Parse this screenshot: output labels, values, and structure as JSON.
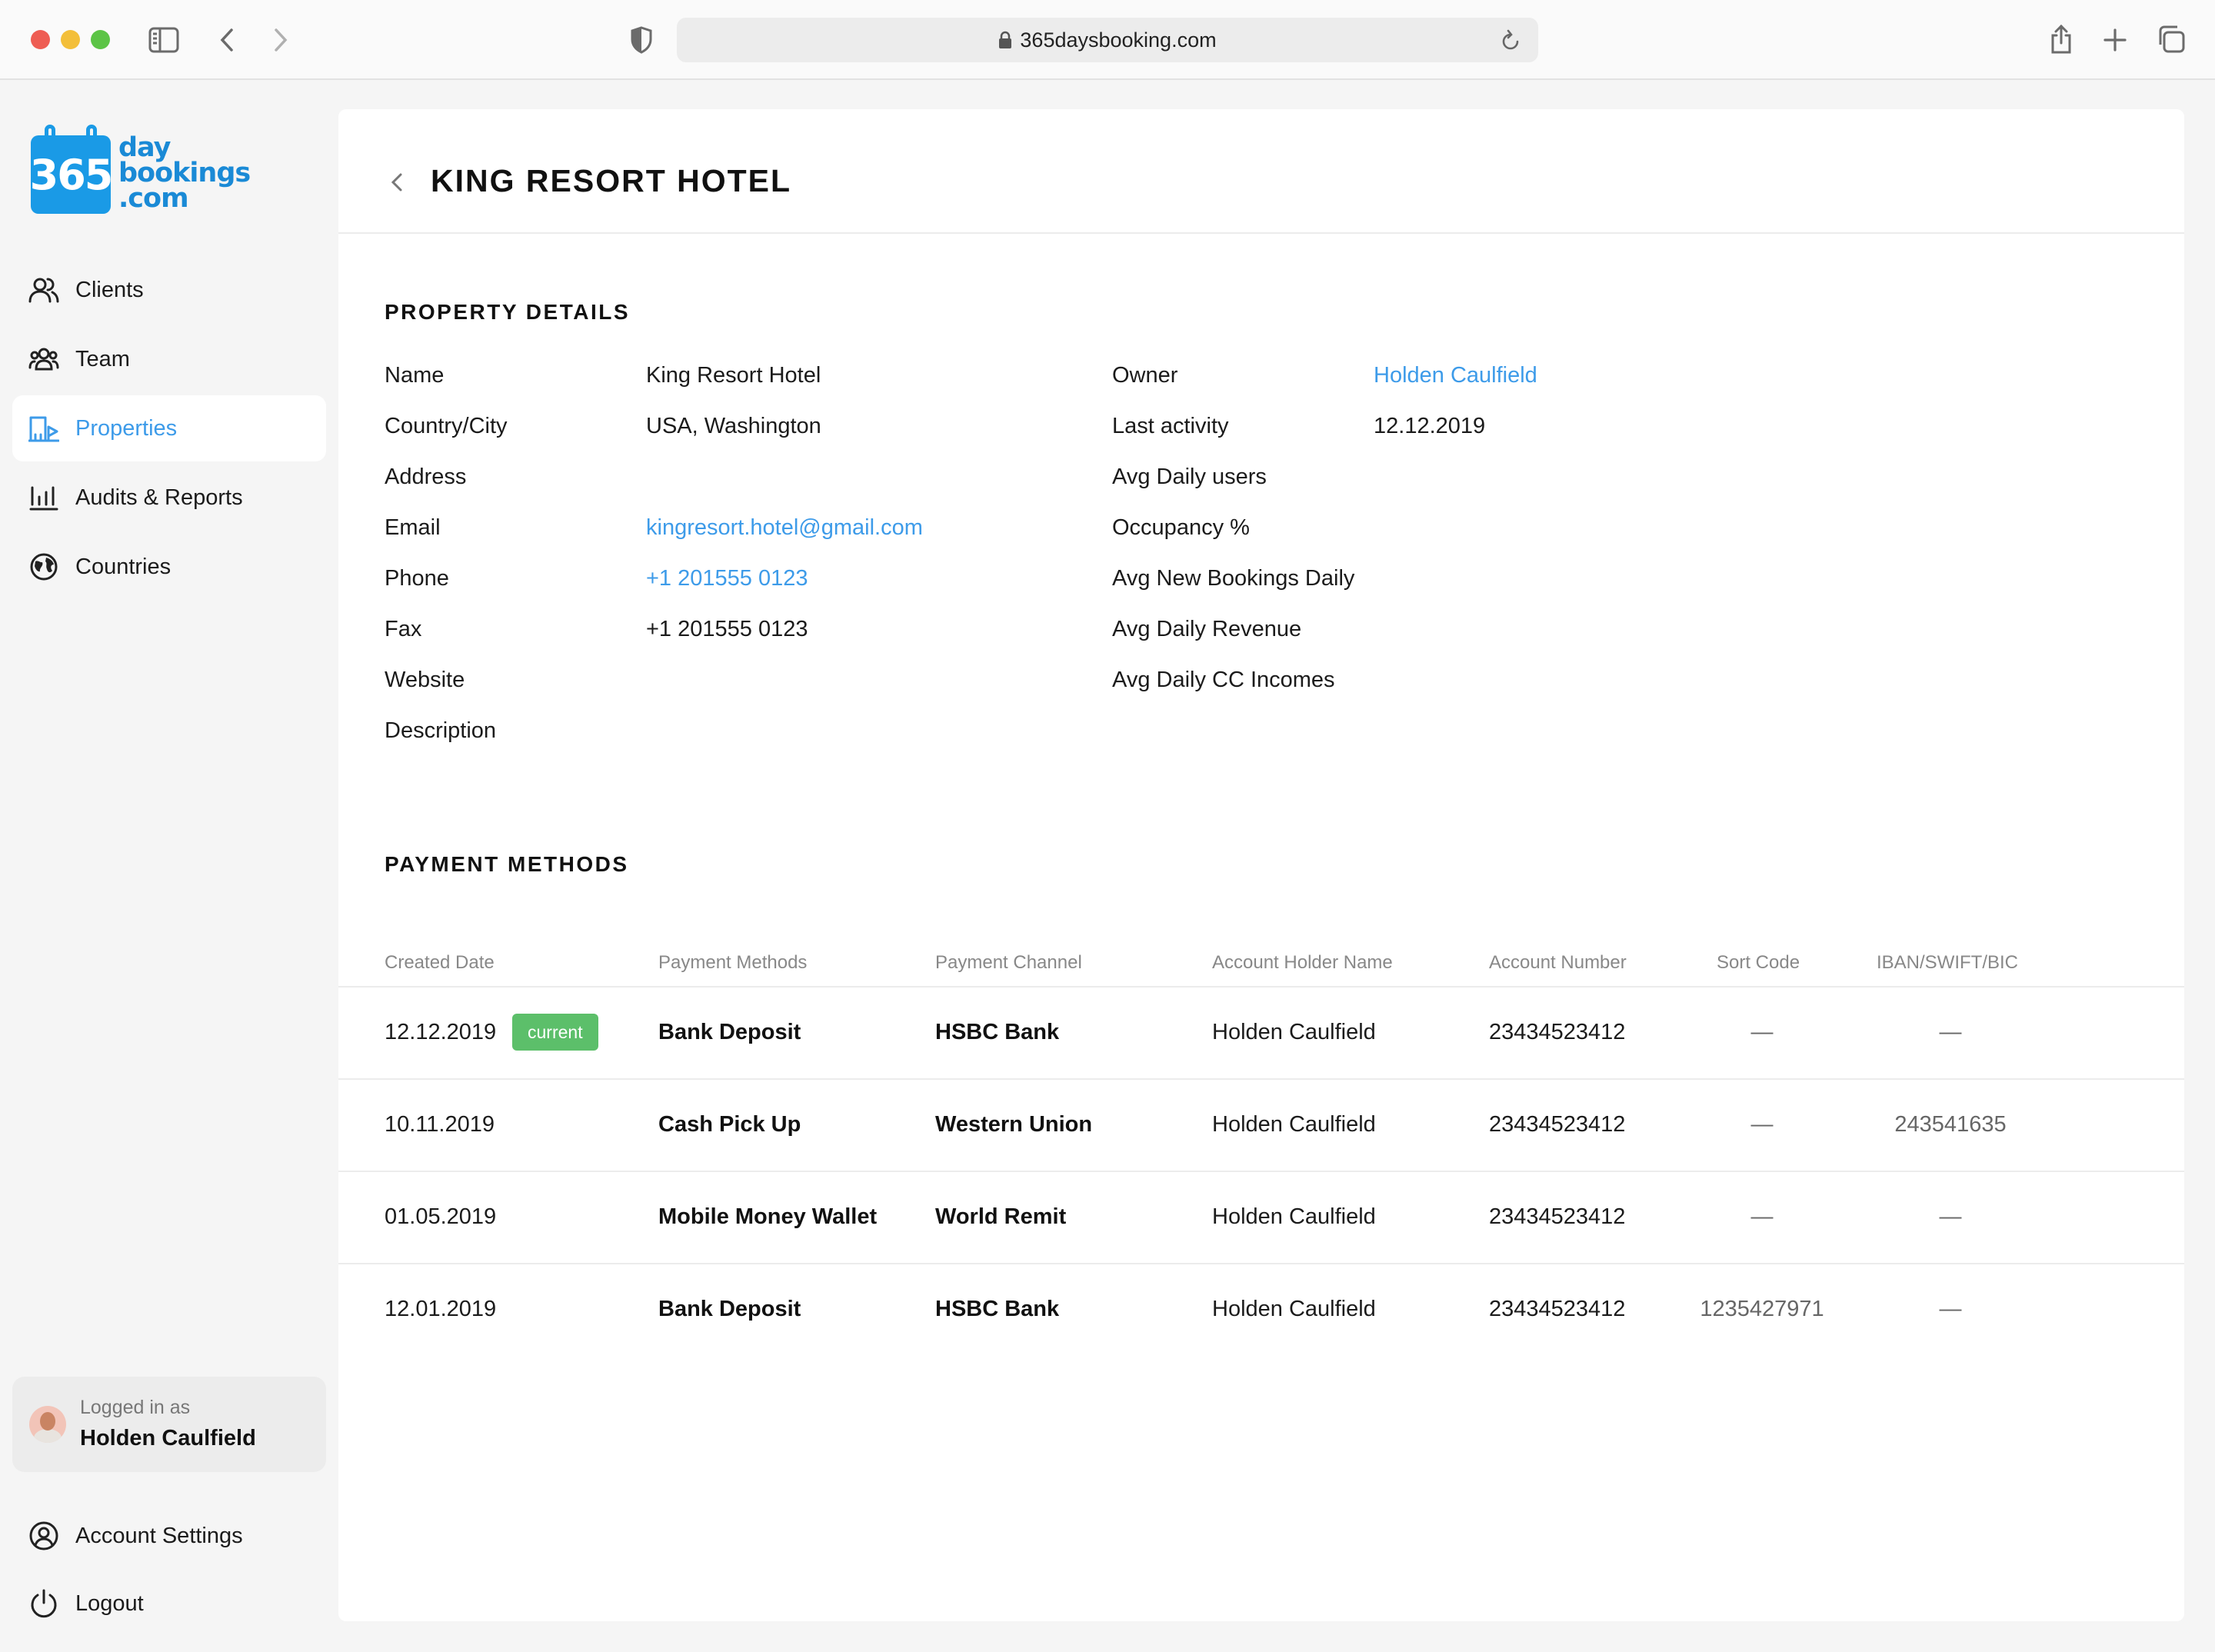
{
  "browser": {
    "url": "365daysbooking.com"
  },
  "logo": {
    "number": "365",
    "line1": "day",
    "line2": "bookings",
    "line3": ".com",
    "color": "#1a9ae6"
  },
  "sidebar": {
    "items": [
      {
        "label": "Clients",
        "icon": "users-icon"
      },
      {
        "label": "Team",
        "icon": "team-icon"
      },
      {
        "label": "Properties",
        "icon": "building-icon",
        "active": true
      },
      {
        "label": "Audits & Reports",
        "icon": "bar-chart-icon"
      },
      {
        "label": "Countries",
        "icon": "globe-icon"
      }
    ],
    "user": {
      "label": "Logged in as",
      "name": "Holden Caulfield"
    },
    "bottom": [
      {
        "label": "Account Settings",
        "icon": "user-circle-icon"
      },
      {
        "label": "Logout",
        "icon": "power-icon"
      }
    ]
  },
  "page": {
    "title": "KING RESORT HOTEL"
  },
  "property": {
    "section_title": "PROPERTY DETAILS",
    "left": [
      {
        "label": "Name",
        "value": "King Resort Hotel"
      },
      {
        "label": "Country/City",
        "value": "USA, Washington"
      },
      {
        "label": "Address",
        "value": ""
      },
      {
        "label": "Email",
        "value": "kingresort.hotel@gmail.com"
      },
      {
        "label": "Phone",
        "value": "+1 201555 0123"
      },
      {
        "label": "Fax",
        "value": "+1 201555 0123"
      },
      {
        "label": "Website",
        "value": ""
      },
      {
        "label": "Description",
        "value": ""
      }
    ],
    "right": [
      {
        "label": "Owner",
        "value": "Holden Caulfield"
      },
      {
        "label": "Last activity",
        "value": "12.12.2019"
      },
      {
        "label": "Avg Daily users",
        "value": ""
      },
      {
        "label": "Occupancy %",
        "value": ""
      },
      {
        "label": "Avg New Bookings Daily",
        "value": ""
      },
      {
        "label": "Avg Daily Revenue",
        "value": ""
      },
      {
        "label": "Avg Daily CC Incomes",
        "value": ""
      }
    ]
  },
  "payments": {
    "section_title": "PAYMENT METHODS",
    "columns": [
      "Created Date",
      "Payment Methods",
      "Payment Channel",
      "Account Holder Name",
      "Account Number",
      "Sort Code",
      "IBAN/SWIFT/BIC"
    ],
    "current_badge": "current",
    "rows": [
      {
        "date": "12.12.2019",
        "method": "Bank Deposit",
        "channel": "HSBC Bank",
        "holder": "Holden Caulfield",
        "account": "23434523412",
        "sort": "—",
        "iban": "—"
      },
      {
        "date": "10.11.2019",
        "method": "Cash Pick Up",
        "channel": "Western Union",
        "holder": "Holden Caulfield",
        "account": "23434523412",
        "sort": "—",
        "iban": "243541635"
      },
      {
        "date": "01.05.2019",
        "method": "Mobile Money Wallet",
        "channel": "World Remit",
        "holder": "Holden Caulfield",
        "account": "23434523412",
        "sort": "—",
        "iban": "—"
      },
      {
        "date": "12.01.2019",
        "method": "Bank Deposit",
        "channel": "HSBC Bank",
        "holder": "Holden Caulfield",
        "account": "23434523412",
        "sort": "1235427971",
        "iban": "—"
      }
    ]
  },
  "colors": {
    "accent": "#3d9be9",
    "badge": "#5cbf6a"
  }
}
